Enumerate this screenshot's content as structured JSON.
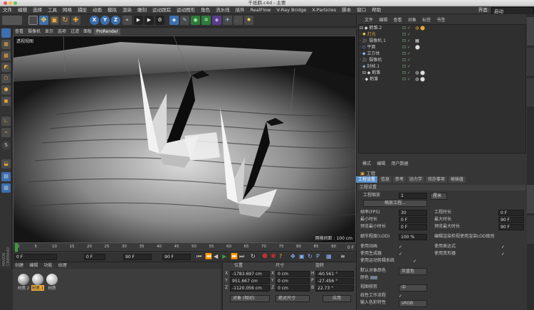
{
  "window": {
    "title": "千纸鹤.c4d - 主要"
  },
  "menu": [
    "文件",
    "编辑",
    "选择",
    "工具",
    "网格",
    "捕捉",
    "动画",
    "模拟",
    "渲染",
    "雕刻",
    "运动跟踪",
    "运动图形",
    "角色",
    "流水线",
    "插件",
    "RealFlow",
    "V-Ray Bridge",
    "X-Particles",
    "脚本",
    "窗口",
    "帮助"
  ],
  "layout": {
    "label": "界面:",
    "value": "启动"
  },
  "viewport": {
    "menu": [
      "查看",
      "摄像机",
      "显示",
      "选项",
      "过滤",
      "面板",
      "ProRender"
    ],
    "camera_label": "透视视图",
    "grid_info": "网格间距 : 100 cm"
  },
  "timeline": {
    "ticks": [
      "0",
      "5",
      "10",
      "15",
      "20",
      "25",
      "30",
      "35",
      "40",
      "45",
      "50",
      "55",
      "60",
      "65",
      "70",
      "75",
      "80",
      "85",
      "90"
    ],
    "frame_right": "0 F",
    "start": "0 F",
    "start2": "0 F",
    "end": "90 F",
    "end2": "90 F"
  },
  "materials": {
    "menu": [
      "创建",
      "编辑",
      "功能",
      "纹理"
    ],
    "items": [
      "材质.2",
      "材质.1",
      "材质"
    ]
  },
  "coords": {
    "headers": [
      "位置",
      "尺寸",
      "旋转"
    ],
    "rows": [
      {
        "axis": "X",
        "pos": "-1783.697 cm",
        "size": "0 cm",
        "rlabel": "H",
        "rot": "-60.561 °"
      },
      {
        "axis": "Y",
        "pos": "951.667 cm",
        "size": "0 cm",
        "rlabel": "P",
        "rot": "-27.456 °"
      },
      {
        "axis": "Z",
        "pos": "-1120.056 cm",
        "size": "0 cm",
        "rlabel": "B",
        "rot": "22.73 °"
      }
    ],
    "mode1": "对象 (相对)",
    "mode2": "绝对尺寸",
    "apply": "应用"
  },
  "objects": {
    "menu": [
      "文件",
      "编辑",
      "查看",
      "对象",
      "标签",
      "书签"
    ],
    "items": [
      "鹤雏.2",
      "灯光",
      "摄像机.1",
      "平面",
      "立方体",
      "摄像机",
      "封帧.1",
      "鹤雏",
      "鹤雏"
    ]
  },
  "attributes": {
    "menu": [
      "模式",
      "编辑",
      "用户数据"
    ],
    "title": "工程",
    "tabs": [
      "工程设置",
      "信息",
      "参考",
      "动力学",
      "待办事项",
      "帧插值"
    ],
    "section": "工程设置",
    "scale_label": "工程缩放",
    "scale_value": "1",
    "scale_unit": "厘米",
    "scale_button": "缩放工程...",
    "fps_label": "帧率(FPS)",
    "fps": "30",
    "duration_label": "工程时长",
    "duration": "0 F",
    "min_label": "最小时长",
    "min": "0 F",
    "max_label": "最大时长",
    "max": "90 F",
    "pmin_label": "预览最小时长",
    "pmin": "0 F",
    "pmax_label": "预览最大时长",
    "pmax": "90 F",
    "lod_label": "细节程度(LOD)",
    "lod": "100 %",
    "renderlod_label": "编辑渲染检视使用渲染LOD级别",
    "anim_label": "使用动画",
    "expr_label": "使用表达式",
    "gen_label": "使用生成器",
    "deform_label": "使用变形器",
    "motion_label": "使用运动剪辑系统",
    "defcolor_label": "默认对象颜色",
    "defcolor": "灰蓝色",
    "color_label": "颜色",
    "clip_label": "视图修剪",
    "clip": "中",
    "linear_label": "线性工作流程",
    "inputcolor_label": "输入色彩特性",
    "inputcolor": "sRGB"
  },
  "colors": {
    "accent": "#5b8fc7",
    "play": "#3c9a3c",
    "record": "#c03030"
  }
}
